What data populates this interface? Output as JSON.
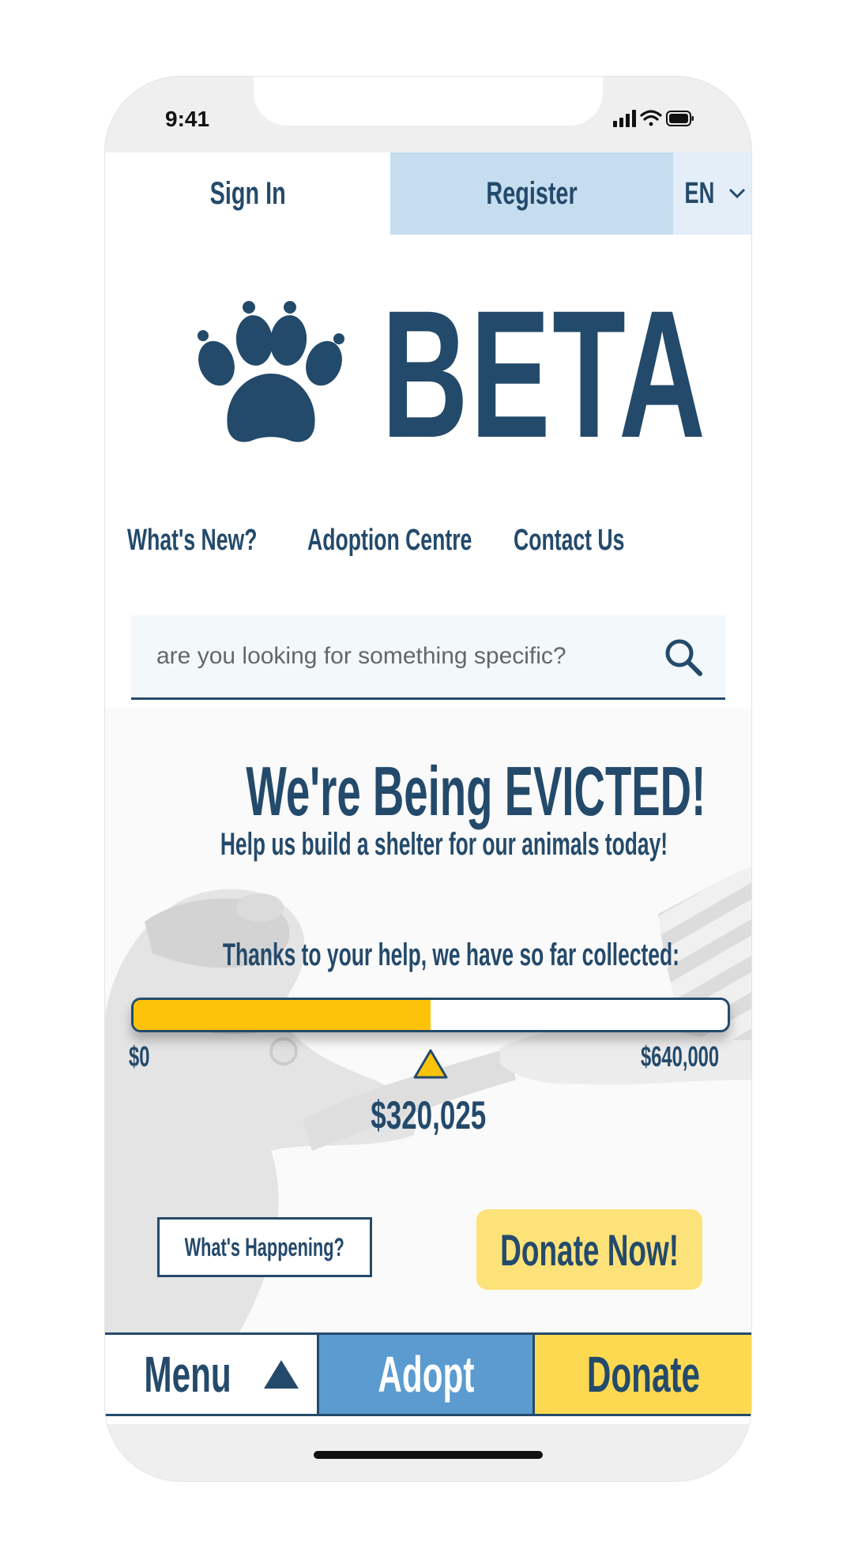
{
  "status_bar": {
    "time": "9:41"
  },
  "header": {
    "sign_in_label": "Sign In",
    "register_label": "Register",
    "language": "EN"
  },
  "logo": {
    "brand_text": "BETA",
    "icon": "paw-icon"
  },
  "nav": {
    "items": [
      {
        "label": "What's New?"
      },
      {
        "label": "Adoption Centre"
      },
      {
        "label": "Contact Us"
      }
    ]
  },
  "search": {
    "placeholder": "are you looking for something specific?",
    "icon": "search-icon"
  },
  "campaign": {
    "title": "We're Being EVICTED!",
    "subtitle": "Help us build a shelter for our animals today!",
    "progress_label": "Thanks to your help, we have so far collected:",
    "min_label": "$0",
    "max_label": "$640,000",
    "current_label": "$320,025",
    "progress_fraction": 0.5,
    "whats_happening_label": "What's Happening?",
    "donate_now_label": "Donate Now!"
  },
  "bottom_nav": {
    "menu_label": "Menu",
    "adopt_label": "Adopt",
    "donate_label": "Donate"
  },
  "colors": {
    "primary": "#244a6b",
    "register_bg": "#c5ddef",
    "progress_fill": "#fdc30a",
    "donate_now_bg": "#fde27a",
    "adopt_bg": "#5b9bd0",
    "donate_bg": "#fdd951"
  }
}
